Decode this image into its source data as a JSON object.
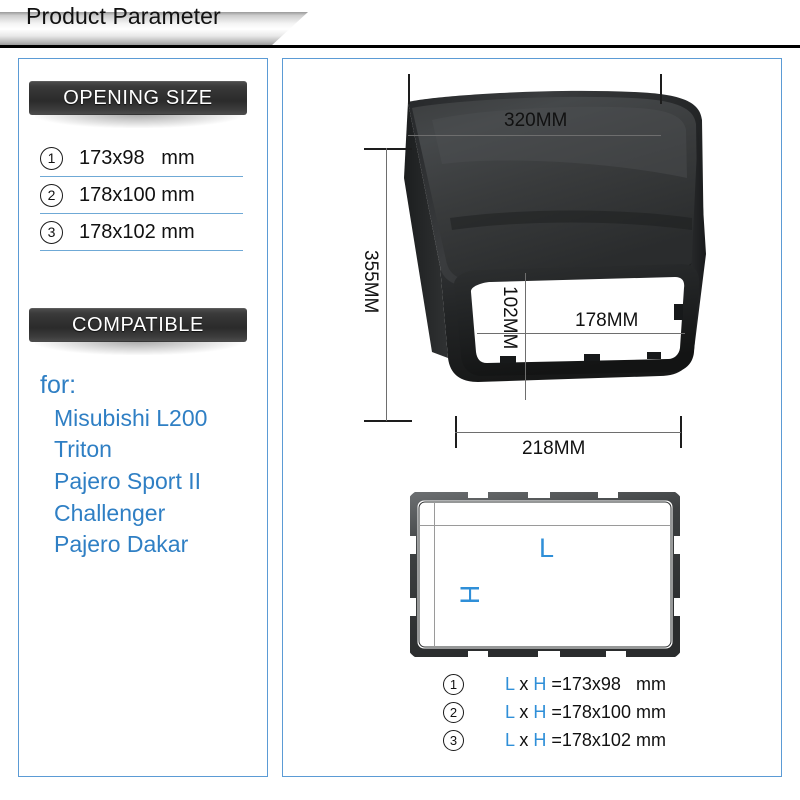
{
  "header": {
    "title": "Product Parameter"
  },
  "left_panel": {
    "opening_size": {
      "plate_label": "OPENING SIZE",
      "rows": [
        {
          "num": "1",
          "text": "173x98   mm"
        },
        {
          "num": "2",
          "text": "178x100 mm"
        },
        {
          "num": "3",
          "text": "178x102 mm"
        }
      ]
    },
    "compatible": {
      "plate_label": "COMPATIBLE",
      "for_label": "for:",
      "models": [
        "Misubishi L200",
        "Triton",
        "Pajero Sport II",
        "Challenger",
        "Pajero Dakar"
      ]
    }
  },
  "right_panel": {
    "product_photo": {
      "alt": "black car dashboard fascia panel",
      "dimensions": {
        "top_width": "320MM",
        "overall_height": "355MM",
        "bottom_width": "218MM",
        "opening_width": "178MM",
        "opening_height": "102MM"
      }
    },
    "frame_diagram": {
      "length_label": "L",
      "height_label": "H"
    },
    "legend": {
      "rows": [
        {
          "num": "1",
          "l": "L",
          "x": " x ",
          "h": "H",
          "value": " =173x98   mm"
        },
        {
          "num": "2",
          "l": "L",
          "x": " x ",
          "h": "H",
          "value": " =178x100 mm"
        },
        {
          "num": "3",
          "l": "L",
          "x": " x ",
          "h": "H",
          "value": " =178x102 mm"
        }
      ]
    }
  },
  "colors": {
    "panel_border": "#5b9bd5",
    "accent_blue": "#2f7fc4",
    "legend_blue": "#2f8fd8",
    "plate_dark": "#303030",
    "dim_line": "#6e6e6e"
  }
}
